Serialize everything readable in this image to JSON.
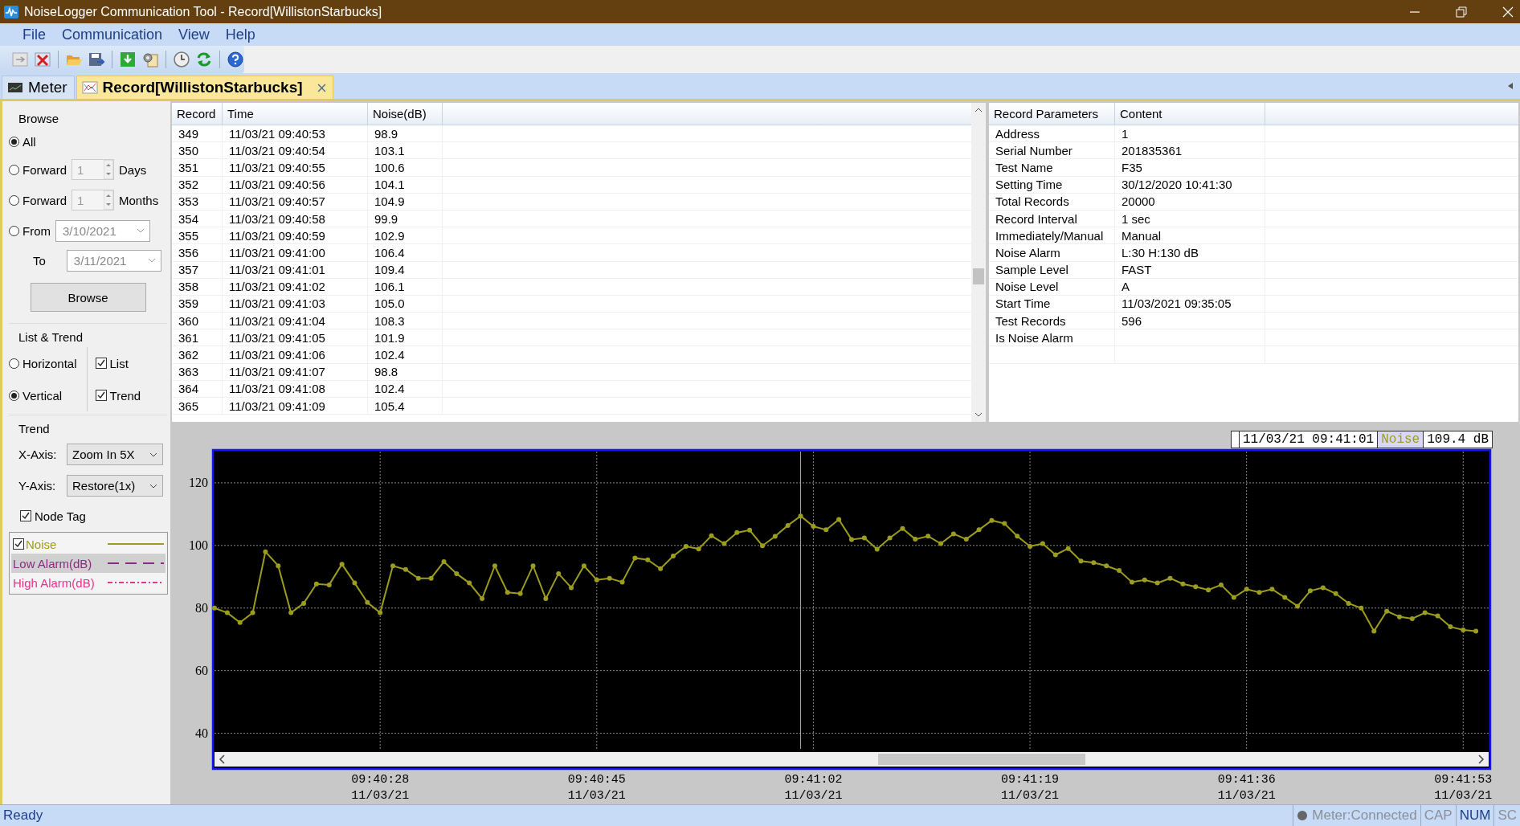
{
  "window": {
    "title": "NoiseLogger Communication Tool - Record[WillistonStarbucks]"
  },
  "menu": [
    "File",
    "Communication",
    "View",
    "Help"
  ],
  "tabs": [
    {
      "label": "Meter",
      "selected": false
    },
    {
      "label": "Record[WillistonStarbucks]",
      "selected": true
    }
  ],
  "browse": {
    "title": "Browse",
    "options": [
      {
        "kind": "plain",
        "label": "All",
        "selected": true
      },
      {
        "kind": "spin",
        "label": "Forward",
        "value": "1",
        "unit": "Days",
        "selected": false
      },
      {
        "kind": "spin",
        "label": "Forward",
        "value": "1",
        "unit": "Months",
        "selected": false
      },
      {
        "kind": "range",
        "label": "From",
        "value": "3/10/2021",
        "to_label": "To",
        "to_value": "3/11/2021",
        "selected": false
      }
    ],
    "button": "Browse"
  },
  "list_trend": {
    "title": "List & Trend",
    "layouts": [
      {
        "label": "Horizontal",
        "selected": false
      },
      {
        "label": "Vertical",
        "selected": true
      }
    ],
    "views": [
      {
        "label": "List",
        "checked": true
      },
      {
        "label": "Trend",
        "checked": true
      }
    ]
  },
  "trend": {
    "title": "Trend",
    "x_axis": {
      "label": "X-Axis:",
      "value": "Zoom In 5X"
    },
    "y_axis": {
      "label": "Y-Axis:",
      "value": "Restore(1x)"
    },
    "node_tag": {
      "label": "Node Tag",
      "checked": true
    },
    "legend": [
      {
        "label": "Noise",
        "kind": "solid",
        "color": "#9c9c1e",
        "checked": true,
        "selected": false
      },
      {
        "label": "Low Alarm(dB)",
        "kind": "dashed",
        "color": "#8e2a83",
        "selected": true
      },
      {
        "label": "High Alarm(dB)",
        "kind": "dashdot",
        "color": "#e8338a",
        "selected": false
      }
    ]
  },
  "records": {
    "columns": [
      "Record",
      "Time",
      "Noise(dB)"
    ],
    "rows": [
      [
        "349",
        "11/03/21 09:40:53",
        "98.9"
      ],
      [
        "350",
        "11/03/21 09:40:54",
        "103.1"
      ],
      [
        "351",
        "11/03/21 09:40:55",
        "100.6"
      ],
      [
        "352",
        "11/03/21 09:40:56",
        "104.1"
      ],
      [
        "353",
        "11/03/21 09:40:57",
        "104.9"
      ],
      [
        "354",
        "11/03/21 09:40:58",
        "99.9"
      ],
      [
        "355",
        "11/03/21 09:40:59",
        "102.9"
      ],
      [
        "356",
        "11/03/21 09:41:00",
        "106.4"
      ],
      [
        "357",
        "11/03/21 09:41:01",
        "109.4"
      ],
      [
        "358",
        "11/03/21 09:41:02",
        "106.1"
      ],
      [
        "359",
        "11/03/21 09:41:03",
        "105.0"
      ],
      [
        "360",
        "11/03/21 09:41:04",
        "108.3"
      ],
      [
        "361",
        "11/03/21 09:41:05",
        "101.9"
      ],
      [
        "362",
        "11/03/21 09:41:06",
        "102.4"
      ],
      [
        "363",
        "11/03/21 09:41:07",
        "98.8"
      ],
      [
        "364",
        "11/03/21 09:41:08",
        "102.4"
      ],
      [
        "365",
        "11/03/21 09:41:09",
        "105.4"
      ]
    ]
  },
  "parameters": {
    "columns": [
      "Record Parameters",
      "Content"
    ],
    "rows": [
      [
        "Address",
        "1"
      ],
      [
        "Serial Number",
        "201835361"
      ],
      [
        "Test Name",
        "F35"
      ],
      [
        "Setting Time",
        "30/12/2020 10:41:30"
      ],
      [
        "Total Records",
        "20000"
      ],
      [
        "Record Interval",
        "1 sec"
      ],
      [
        "Immediately/Manual",
        "Manual"
      ],
      [
        "Noise Alarm",
        "L:30 H:130 dB"
      ],
      [
        "Sample Level",
        "FAST"
      ],
      [
        "Noise Level",
        "A"
      ],
      [
        "Start Time",
        "11/03/2021 09:35:05"
      ],
      [
        "Test Records",
        "596"
      ],
      [
        "Is Noise Alarm"
      ]
    ]
  },
  "trend_chart": {
    "readout": {
      "time": "11/03/21 09:41:01",
      "value": "109.4 dB"
    },
    "chart_data": {
      "type": "line",
      "categories": [
        null,
        null,
        null,
        null,
        null,
        null,
        null,
        null,
        null,
        null,
        null,
        null,
        null,
        "09:40:28 11/03/21",
        null,
        null,
        null,
        null,
        null,
        null,
        null,
        null,
        null,
        null,
        null,
        null,
        null,
        null,
        null,
        null,
        "09:40:45 11/03/21",
        null,
        null,
        null,
        null,
        null,
        null,
        null,
        null,
        null,
        null,
        null,
        null,
        null,
        null,
        null,
        null,
        "09:41:02 11/03/21",
        null,
        null,
        null,
        null,
        null,
        null,
        null,
        null,
        null,
        null,
        null,
        null,
        null,
        null,
        null,
        null,
        "09:41:19 11/03/21",
        null,
        null,
        null,
        null,
        null,
        null,
        null,
        null,
        null,
        null,
        null,
        null,
        null,
        null,
        null,
        null,
        "09:41:36 11/03/21",
        null,
        null,
        null,
        null,
        null,
        null,
        null,
        null,
        null,
        null,
        null,
        null,
        null,
        null,
        null,
        null,
        "09:41:53 11/03/21",
        null
      ],
      "series": [
        {
          "name": "Noise",
          "color": "#9c9c1e",
          "marker": true,
          "values": [
            80,
            78.5,
            75.4,
            78.5,
            98,
            93.5,
            78.5,
            81.5,
            87.7,
            87.4,
            94,
            88,
            81.8,
            78.5,
            93.5,
            92.3,
            89.5,
            89.5,
            94.8,
            91,
            88,
            83,
            93.5,
            85,
            84.6,
            93.5,
            83,
            91,
            86.5,
            93.5,
            89,
            89.5,
            88.3,
            96,
            95.4,
            92.6,
            96.6,
            99.7,
            98.9,
            103.1,
            100.6,
            104.1,
            104.9,
            99.9,
            102.9,
            106.4,
            109.4,
            106.1,
            105.0,
            108.3,
            101.9,
            102.4,
            98.8,
            102.4,
            105.4,
            102,
            103,
            100.6,
            103.7,
            102,
            105,
            108,
            107,
            103,
            99.7,
            100.6,
            97,
            99,
            95,
            94.5,
            93.5,
            92,
            88.3,
            89,
            88,
            89.5,
            87.7,
            86.8,
            85.8,
            87.4,
            83.4,
            86,
            85,
            86,
            83.4,
            80.6,
            85.5,
            86.5,
            84.6,
            81.5,
            80,
            72.6,
            79,
            77.2,
            76.6,
            78.5,
            77.5,
            74,
            73,
            72.6
          ]
        }
      ],
      "ylim": [
        35,
        130
      ],
      "yticks": [
        40,
        60,
        80,
        100,
        120
      ],
      "grid": true
    }
  },
  "status_bar": {
    "message": "Ready",
    "indicators": [
      {
        "label": "Meter:Connected",
        "disabled": true
      },
      {
        "label": "CAP",
        "disabled": true
      },
      {
        "label": "NUM",
        "disabled": false
      },
      {
        "label": "SC",
        "disabled": true
      }
    ]
  }
}
